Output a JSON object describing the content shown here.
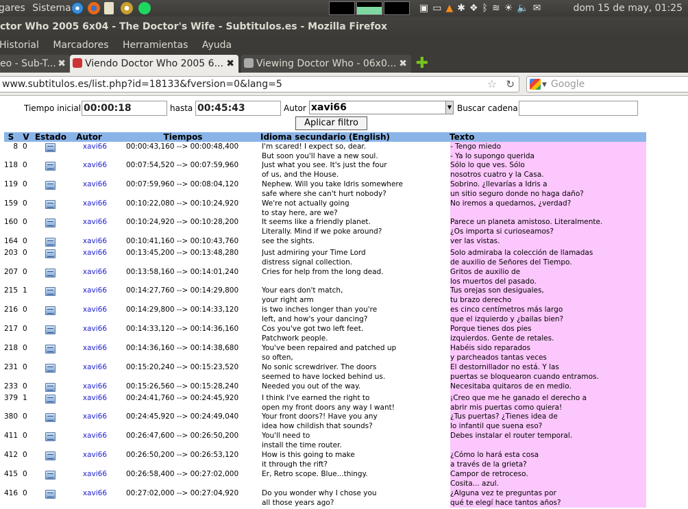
{
  "panel": {
    "menu_places": "gares",
    "menu_system": "Sistema",
    "clock": "dom 15 de may, 01:25"
  },
  "window": {
    "title": "ctor Who 2005 6x04 - The Doctor's Wife - Subtitulos.es - Mozilla Firefox"
  },
  "menubar": [
    "Historial",
    "Marcadores",
    "Herramientas",
    "Ayuda"
  ],
  "tabs": [
    {
      "label": "eo - Sub-T...",
      "active": false
    },
    {
      "label": "Viendo Doctor Who 2005 6...",
      "active": true
    },
    {
      "label": "Viewing Doctor Who - 06x0...",
      "active": false
    }
  ],
  "navbar": {
    "url": "www.subtitulos.es/list.php?id=18133&fversion=0&lang=5",
    "search_placeholder": "Google"
  },
  "filters": {
    "tiempo_inicial_label": "Tiempo inicial",
    "tiempo_inicial_value": "00:00:18",
    "hasta_label": "hasta",
    "hasta_value": "00:45:43",
    "autor_label": "Autor",
    "autor_value": "xavi66",
    "buscar_label": "Buscar cadena",
    "buscar_value": "",
    "apply_label": "Aplicar filtro"
  },
  "table": {
    "headers": [
      "S",
      "V",
      "Estado",
      "Autor",
      "Tiempos",
      "Idioma secundario (English)",
      "Texto"
    ],
    "rows": [
      {
        "s": "8",
        "v": "0",
        "autor": "xavi66",
        "tiempos": "00:00:43,160 --> 00:00:48,400",
        "en": [
          "I'm scared! I expect so, dear.",
          "But soon you'll have a new soul."
        ],
        "es": [
          "- Tengo miedo",
          "- Ya lo supongo querida"
        ]
      },
      {
        "s": "118",
        "v": "0",
        "autor": "xavi66",
        "tiempos": "00:07:54,520 --> 00:07:59,960",
        "en": [
          "Just what you see. It's just the four",
          "of us, and the House."
        ],
        "es": [
          "Sólo lo que ves. Sólo",
          "nosotros cuatro y la Casa."
        ]
      },
      {
        "s": "119",
        "v": "0",
        "autor": "xavi66",
        "tiempos": "00:07:59,960 --> 00:08:04,120",
        "en": [
          "Nephew. Will you take Idris somewhere",
          "safe where she can't hurt nobody?"
        ],
        "es": [
          "Sobrino. ¿llevarías a Idris a",
          "un sitio seguro donde no haga daño?"
        ]
      },
      {
        "s": "159",
        "v": "0",
        "autor": "xavi66",
        "tiempos": "00:10:22,080 --> 00:10:24,920",
        "en": [
          "We're not actually going",
          "to stay here, are we?"
        ],
        "es": [
          "No iremos a quedarnos, ¿verdad?"
        ]
      },
      {
        "s": "160",
        "v": "0",
        "autor": "xavi66",
        "tiempos": "00:10:24,920 --> 00:10:28,200",
        "en": [
          "It seems like a friendly planet.",
          "Literally. Mind if we poke around?"
        ],
        "es": [
          "Parece un planeta amistoso. Literalmente.",
          "¿Os importa si curioseamos?"
        ]
      },
      {
        "s": "164",
        "v": "0",
        "autor": "xavi66",
        "tiempos": "00:10:41,160 --> 00:10:43,760",
        "en": [
          "see the sights."
        ],
        "es": [
          "ver las vistas."
        ]
      },
      {
        "s": "203",
        "v": "0",
        "autor": "xavi66",
        "tiempos": "00:13:45,200 --> 00:13:48,280",
        "en": [
          "Just admiring your Time Lord",
          "distress signal collection."
        ],
        "es": [
          "Solo admiraba la colección de llamadas",
          "de auxilio de Señores del Tiempo."
        ]
      },
      {
        "s": "207",
        "v": "0",
        "autor": "xavi66",
        "tiempos": "00:13:58,160 --> 00:14:01,240",
        "en": [
          "Cries for help from the long dead."
        ],
        "es": [
          "Gritos de auxilio de",
          "los muertos del pasado."
        ]
      },
      {
        "s": "215",
        "v": "1",
        "autor": "xavi66",
        "tiempos": "00:14:27,760 --> 00:14:29,800",
        "en": [
          "Your ears don't match,",
          "your right arm"
        ],
        "es": [
          "Tus orejas son desiguales,",
          "tu brazo derecho"
        ]
      },
      {
        "s": "216",
        "v": "0",
        "autor": "xavi66",
        "tiempos": "00:14:29,800 --> 00:14:33,120",
        "en": [
          "is two inches longer than you're",
          "left, and how's your dancing?"
        ],
        "es": [
          "es cinco centímetros más largo",
          "que el izquierdo y ¿bailas bien?"
        ]
      },
      {
        "s": "217",
        "v": "0",
        "autor": "xavi66",
        "tiempos": "00:14:33,120 --> 00:14:36,160",
        "en": [
          "Cos you've got two left feet.",
          "Patchwork people."
        ],
        "es": [
          "Porque tienes dos pies",
          "izquierdos. Gente de retales."
        ]
      },
      {
        "s": "218",
        "v": "0",
        "autor": "xavi66",
        "tiempos": "00:14:36,160 --> 00:14:38,680",
        "en": [
          "You've been repaired and patched up",
          "so often,"
        ],
        "es": [
          "Habéis sido reparados",
          "y parcheados tantas veces"
        ]
      },
      {
        "s": "231",
        "v": "0",
        "autor": "xavi66",
        "tiempos": "00:15:20,240 --> 00:15:23,520",
        "en": [
          "No sonic screwdriver. The doors",
          "seemed to have locked behind us."
        ],
        "es": [
          "El destornillador no está. Y las",
          "puertas se bloquearon cuando entramos."
        ]
      },
      {
        "s": "233",
        "v": "0",
        "autor": "xavi66",
        "tiempos": "00:15:26,560 --> 00:15:28,240",
        "en": [
          "Needed you out of the way."
        ],
        "es": [
          "Necesitaba quitaros de en medio."
        ]
      },
      {
        "s": "379",
        "v": "1",
        "autor": "xavi66",
        "tiempos": "00:24:41,760 --> 00:24:45,920",
        "en": [
          "I think I've earned the right to",
          "open my front doors any way I want!"
        ],
        "es": [
          "¡Creo que me he ganado el derecho a",
          "abrir mis puertas como quiera!"
        ]
      },
      {
        "s": "380",
        "v": "0",
        "autor": "xavi66",
        "tiempos": "00:24:45,920 --> 00:24:49,040",
        "en": [
          "Your front doors?! Have you any",
          "idea how childish that sounds?"
        ],
        "es": [
          "¿Tus puertas? ¿Tienes idea de",
          "lo infantil que suena eso?"
        ]
      },
      {
        "s": "411",
        "v": "0",
        "autor": "xavi66",
        "tiempos": "00:26:47,600 --> 00:26:50,200",
        "en": [
          "You'll need to",
          "install the time router."
        ],
        "es": [
          "Debes instalar el router temporal."
        ]
      },
      {
        "s": "412",
        "v": "0",
        "autor": "xavi66",
        "tiempos": "00:26:50,200 --> 00:26:53,120",
        "en": [
          "How is this going to make",
          "it through the rift?"
        ],
        "es": [
          "¿Cómo lo hará esta cosa",
          "a través de la grieta?"
        ]
      },
      {
        "s": "415",
        "v": "0",
        "autor": "xavi66",
        "tiempos": "00:26:58,400 --> 00:27:02,000",
        "en": [
          "Er, Retro scope. Blue...thingy."
        ],
        "es": [
          "Campor de retroceso.",
          "Cosita... azul."
        ]
      },
      {
        "s": "416",
        "v": "0",
        "autor": "xavi66",
        "tiempos": "00:27:02,000 --> 00:27:04,920",
        "en": [
          "Do you wonder why I chose you",
          "all those years ago?"
        ],
        "es": [
          "¿Alguna vez te preguntas por",
          "qué te elegí hace tantos años?"
        ]
      }
    ]
  }
}
